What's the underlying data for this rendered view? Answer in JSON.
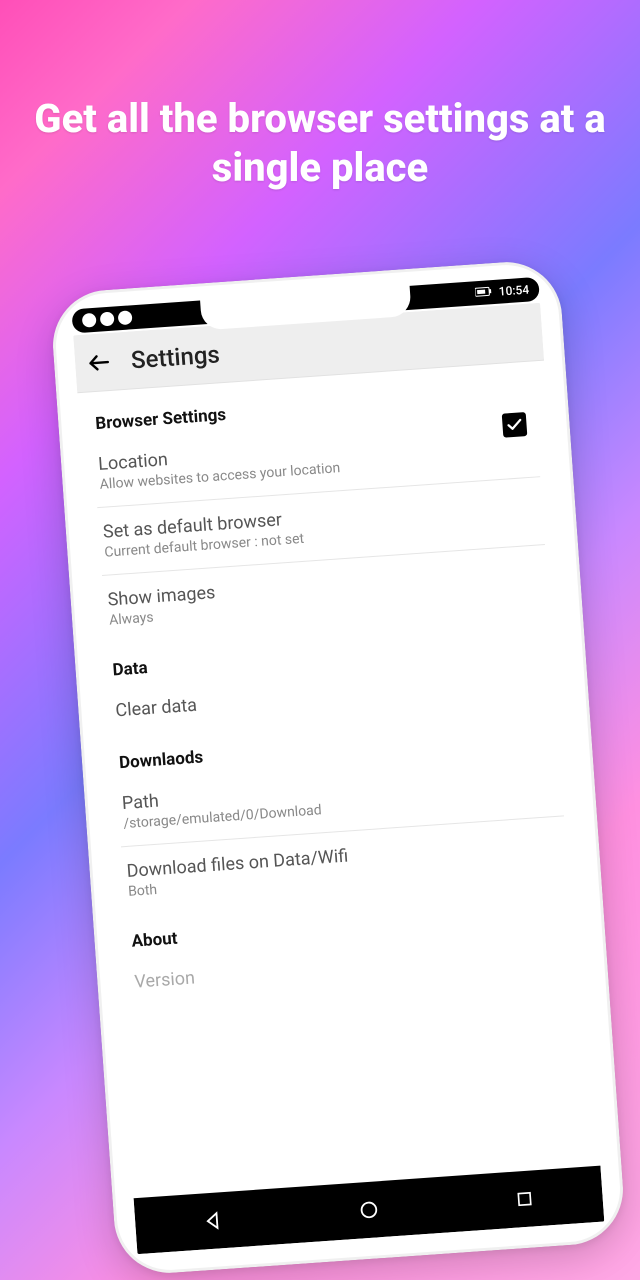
{
  "headline": "Get all the browser settings at a single place",
  "status": {
    "time": "10:54"
  },
  "appbar": {
    "title": "Settings"
  },
  "browser": {
    "section": "Browser Settings",
    "location": {
      "title": "Location",
      "sub": "Allow websites to access your location",
      "checked": true
    },
    "default_browser": {
      "title": "Set as default browser",
      "sub": "Current default browser : not set"
    },
    "show_images": {
      "title": "Show images",
      "sub": "Always"
    }
  },
  "data": {
    "section": "Data",
    "clear": {
      "title": "Clear data"
    }
  },
  "downloads": {
    "section": "Downlaods",
    "path": {
      "title": "Path",
      "sub": "/storage/emulated/0/Download"
    },
    "mode": {
      "title": "Download files on Data/Wifi",
      "sub": "Both"
    }
  },
  "about": {
    "section": "About",
    "version": {
      "title": "Version"
    }
  }
}
